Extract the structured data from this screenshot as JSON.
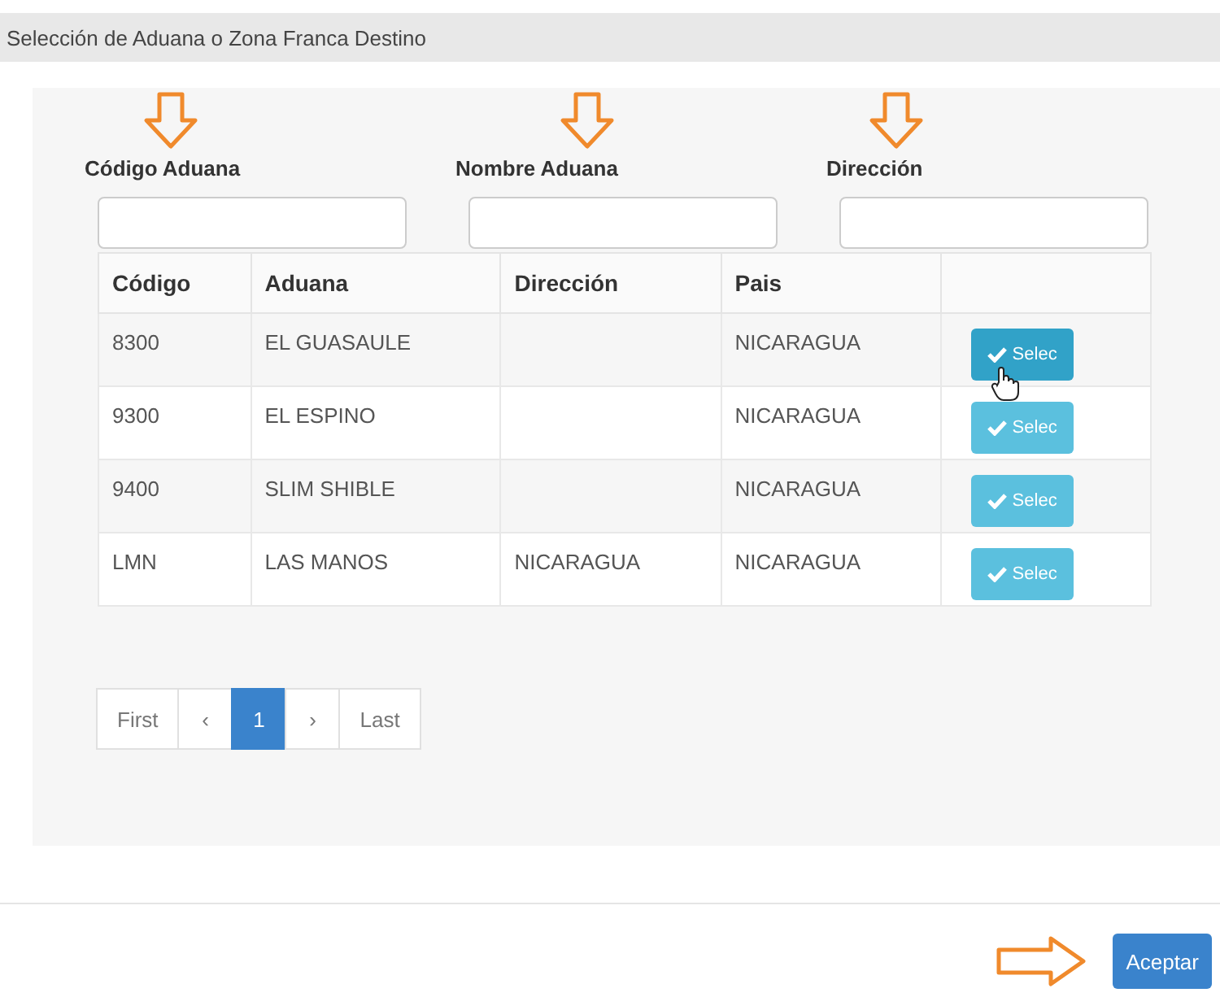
{
  "window": {
    "title": "Selección de Aduana o Zona Franca Destino"
  },
  "filters": [
    {
      "label": "Código Aduana"
    },
    {
      "label": "Nombre Aduana"
    },
    {
      "label": "Dirección"
    }
  ],
  "table": {
    "columns": [
      "Código",
      "Aduana",
      "Dirección",
      "Pais"
    ],
    "rows": [
      {
        "cells": [
          "8300",
          "EL GUASAULE",
          null,
          "NICARAGUA"
        ],
        "button": "Selec",
        "hovered": true
      },
      {
        "cells": [
          "9300",
          "EL ESPINO",
          null,
          "NICARAGUA"
        ],
        "button": "Selec",
        "hovered": false
      },
      {
        "cells": [
          "9400",
          "SLIM SHIBLE",
          null,
          "NICARAGUA"
        ],
        "button": "Selec",
        "hovered": false
      },
      {
        "cells": [
          "LMN",
          "LAS MANOS",
          "NICARAGUA",
          "NICARAGUA"
        ],
        "button": "Selec",
        "hovered": false
      }
    ]
  },
  "pagination": [
    {
      "label": "First",
      "selected": false
    },
    {
      "label": "‹",
      "selected": false
    },
    {
      "label": "1",
      "selected": true
    },
    {
      "label": "›",
      "selected": false
    },
    {
      "label": "Last",
      "selected": false
    }
  ],
  "footer": {
    "button": "Aceptar"
  }
}
